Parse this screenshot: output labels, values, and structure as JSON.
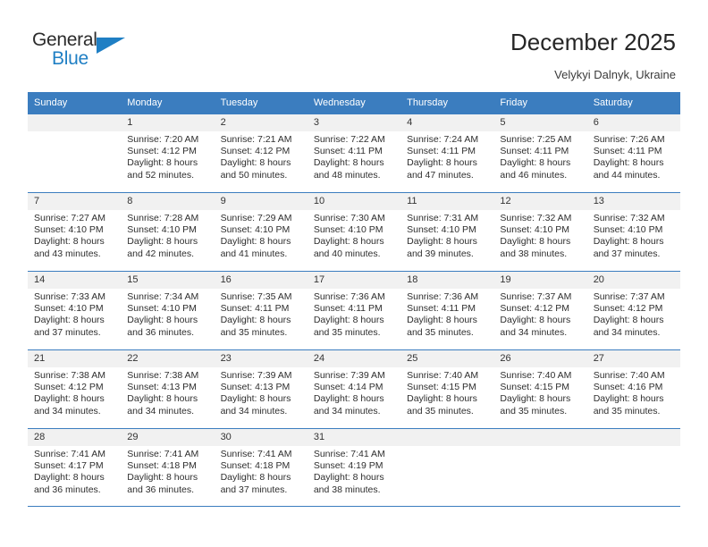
{
  "brand": {
    "word_one": "General",
    "word_two": "Blue",
    "accent_color": "#1f7fc4"
  },
  "header": {
    "title": "December 2025",
    "subtitle": "Velykyi Dalnyk, Ukraine"
  },
  "calendar": {
    "header_color": "#3b7dbf",
    "weekday_headers": [
      "Sunday",
      "Monday",
      "Tuesday",
      "Wednesday",
      "Thursday",
      "Friday",
      "Saturday"
    ],
    "weeks": [
      [
        {
          "day": "",
          "sunrise": "",
          "sunset": "",
          "daylight_line1": "",
          "daylight_line2": ""
        },
        {
          "day": "1",
          "sunrise": "Sunrise: 7:20 AM",
          "sunset": "Sunset: 4:12 PM",
          "daylight_line1": "Daylight: 8 hours",
          "daylight_line2": "and 52 minutes."
        },
        {
          "day": "2",
          "sunrise": "Sunrise: 7:21 AM",
          "sunset": "Sunset: 4:12 PM",
          "daylight_line1": "Daylight: 8 hours",
          "daylight_line2": "and 50 minutes."
        },
        {
          "day": "3",
          "sunrise": "Sunrise: 7:22 AM",
          "sunset": "Sunset: 4:11 PM",
          "daylight_line1": "Daylight: 8 hours",
          "daylight_line2": "and 48 minutes."
        },
        {
          "day": "4",
          "sunrise": "Sunrise: 7:24 AM",
          "sunset": "Sunset: 4:11 PM",
          "daylight_line1": "Daylight: 8 hours",
          "daylight_line2": "and 47 minutes."
        },
        {
          "day": "5",
          "sunrise": "Sunrise: 7:25 AM",
          "sunset": "Sunset: 4:11 PM",
          "daylight_line1": "Daylight: 8 hours",
          "daylight_line2": "and 46 minutes."
        },
        {
          "day": "6",
          "sunrise": "Sunrise: 7:26 AM",
          "sunset": "Sunset: 4:11 PM",
          "daylight_line1": "Daylight: 8 hours",
          "daylight_line2": "and 44 minutes."
        }
      ],
      [
        {
          "day": "7",
          "sunrise": "Sunrise: 7:27 AM",
          "sunset": "Sunset: 4:10 PM",
          "daylight_line1": "Daylight: 8 hours",
          "daylight_line2": "and 43 minutes."
        },
        {
          "day": "8",
          "sunrise": "Sunrise: 7:28 AM",
          "sunset": "Sunset: 4:10 PM",
          "daylight_line1": "Daylight: 8 hours",
          "daylight_line2": "and 42 minutes."
        },
        {
          "day": "9",
          "sunrise": "Sunrise: 7:29 AM",
          "sunset": "Sunset: 4:10 PM",
          "daylight_line1": "Daylight: 8 hours",
          "daylight_line2": "and 41 minutes."
        },
        {
          "day": "10",
          "sunrise": "Sunrise: 7:30 AM",
          "sunset": "Sunset: 4:10 PM",
          "daylight_line1": "Daylight: 8 hours",
          "daylight_line2": "and 40 minutes."
        },
        {
          "day": "11",
          "sunrise": "Sunrise: 7:31 AM",
          "sunset": "Sunset: 4:10 PM",
          "daylight_line1": "Daylight: 8 hours",
          "daylight_line2": "and 39 minutes."
        },
        {
          "day": "12",
          "sunrise": "Sunrise: 7:32 AM",
          "sunset": "Sunset: 4:10 PM",
          "daylight_line1": "Daylight: 8 hours",
          "daylight_line2": "and 38 minutes."
        },
        {
          "day": "13",
          "sunrise": "Sunrise: 7:32 AM",
          "sunset": "Sunset: 4:10 PM",
          "daylight_line1": "Daylight: 8 hours",
          "daylight_line2": "and 37 minutes."
        }
      ],
      [
        {
          "day": "14",
          "sunrise": "Sunrise: 7:33 AM",
          "sunset": "Sunset: 4:10 PM",
          "daylight_line1": "Daylight: 8 hours",
          "daylight_line2": "and 37 minutes."
        },
        {
          "day": "15",
          "sunrise": "Sunrise: 7:34 AM",
          "sunset": "Sunset: 4:10 PM",
          "daylight_line1": "Daylight: 8 hours",
          "daylight_line2": "and 36 minutes."
        },
        {
          "day": "16",
          "sunrise": "Sunrise: 7:35 AM",
          "sunset": "Sunset: 4:11 PM",
          "daylight_line1": "Daylight: 8 hours",
          "daylight_line2": "and 35 minutes."
        },
        {
          "day": "17",
          "sunrise": "Sunrise: 7:36 AM",
          "sunset": "Sunset: 4:11 PM",
          "daylight_line1": "Daylight: 8 hours",
          "daylight_line2": "and 35 minutes."
        },
        {
          "day": "18",
          "sunrise": "Sunrise: 7:36 AM",
          "sunset": "Sunset: 4:11 PM",
          "daylight_line1": "Daylight: 8 hours",
          "daylight_line2": "and 35 minutes."
        },
        {
          "day": "19",
          "sunrise": "Sunrise: 7:37 AM",
          "sunset": "Sunset: 4:12 PM",
          "daylight_line1": "Daylight: 8 hours",
          "daylight_line2": "and 34 minutes."
        },
        {
          "day": "20",
          "sunrise": "Sunrise: 7:37 AM",
          "sunset": "Sunset: 4:12 PM",
          "daylight_line1": "Daylight: 8 hours",
          "daylight_line2": "and 34 minutes."
        }
      ],
      [
        {
          "day": "21",
          "sunrise": "Sunrise: 7:38 AM",
          "sunset": "Sunset: 4:12 PM",
          "daylight_line1": "Daylight: 8 hours",
          "daylight_line2": "and 34 minutes."
        },
        {
          "day": "22",
          "sunrise": "Sunrise: 7:38 AM",
          "sunset": "Sunset: 4:13 PM",
          "daylight_line1": "Daylight: 8 hours",
          "daylight_line2": "and 34 minutes."
        },
        {
          "day": "23",
          "sunrise": "Sunrise: 7:39 AM",
          "sunset": "Sunset: 4:13 PM",
          "daylight_line1": "Daylight: 8 hours",
          "daylight_line2": "and 34 minutes."
        },
        {
          "day": "24",
          "sunrise": "Sunrise: 7:39 AM",
          "sunset": "Sunset: 4:14 PM",
          "daylight_line1": "Daylight: 8 hours",
          "daylight_line2": "and 34 minutes."
        },
        {
          "day": "25",
          "sunrise": "Sunrise: 7:40 AM",
          "sunset": "Sunset: 4:15 PM",
          "daylight_line1": "Daylight: 8 hours",
          "daylight_line2": "and 35 minutes."
        },
        {
          "day": "26",
          "sunrise": "Sunrise: 7:40 AM",
          "sunset": "Sunset: 4:15 PM",
          "daylight_line1": "Daylight: 8 hours",
          "daylight_line2": "and 35 minutes."
        },
        {
          "day": "27",
          "sunrise": "Sunrise: 7:40 AM",
          "sunset": "Sunset: 4:16 PM",
          "daylight_line1": "Daylight: 8 hours",
          "daylight_line2": "and 35 minutes."
        }
      ],
      [
        {
          "day": "28",
          "sunrise": "Sunrise: 7:41 AM",
          "sunset": "Sunset: 4:17 PM",
          "daylight_line1": "Daylight: 8 hours",
          "daylight_line2": "and 36 minutes."
        },
        {
          "day": "29",
          "sunrise": "Sunrise: 7:41 AM",
          "sunset": "Sunset: 4:18 PM",
          "daylight_line1": "Daylight: 8 hours",
          "daylight_line2": "and 36 minutes."
        },
        {
          "day": "30",
          "sunrise": "Sunrise: 7:41 AM",
          "sunset": "Sunset: 4:18 PM",
          "daylight_line1": "Daylight: 8 hours",
          "daylight_line2": "and 37 minutes."
        },
        {
          "day": "31",
          "sunrise": "Sunrise: 7:41 AM",
          "sunset": "Sunset: 4:19 PM",
          "daylight_line1": "Daylight: 8 hours",
          "daylight_line2": "and 38 minutes."
        },
        {
          "day": "",
          "sunrise": "",
          "sunset": "",
          "daylight_line1": "",
          "daylight_line2": ""
        },
        {
          "day": "",
          "sunrise": "",
          "sunset": "",
          "daylight_line1": "",
          "daylight_line2": ""
        },
        {
          "day": "",
          "sunrise": "",
          "sunset": "",
          "daylight_line1": "",
          "daylight_line2": ""
        }
      ]
    ]
  }
}
